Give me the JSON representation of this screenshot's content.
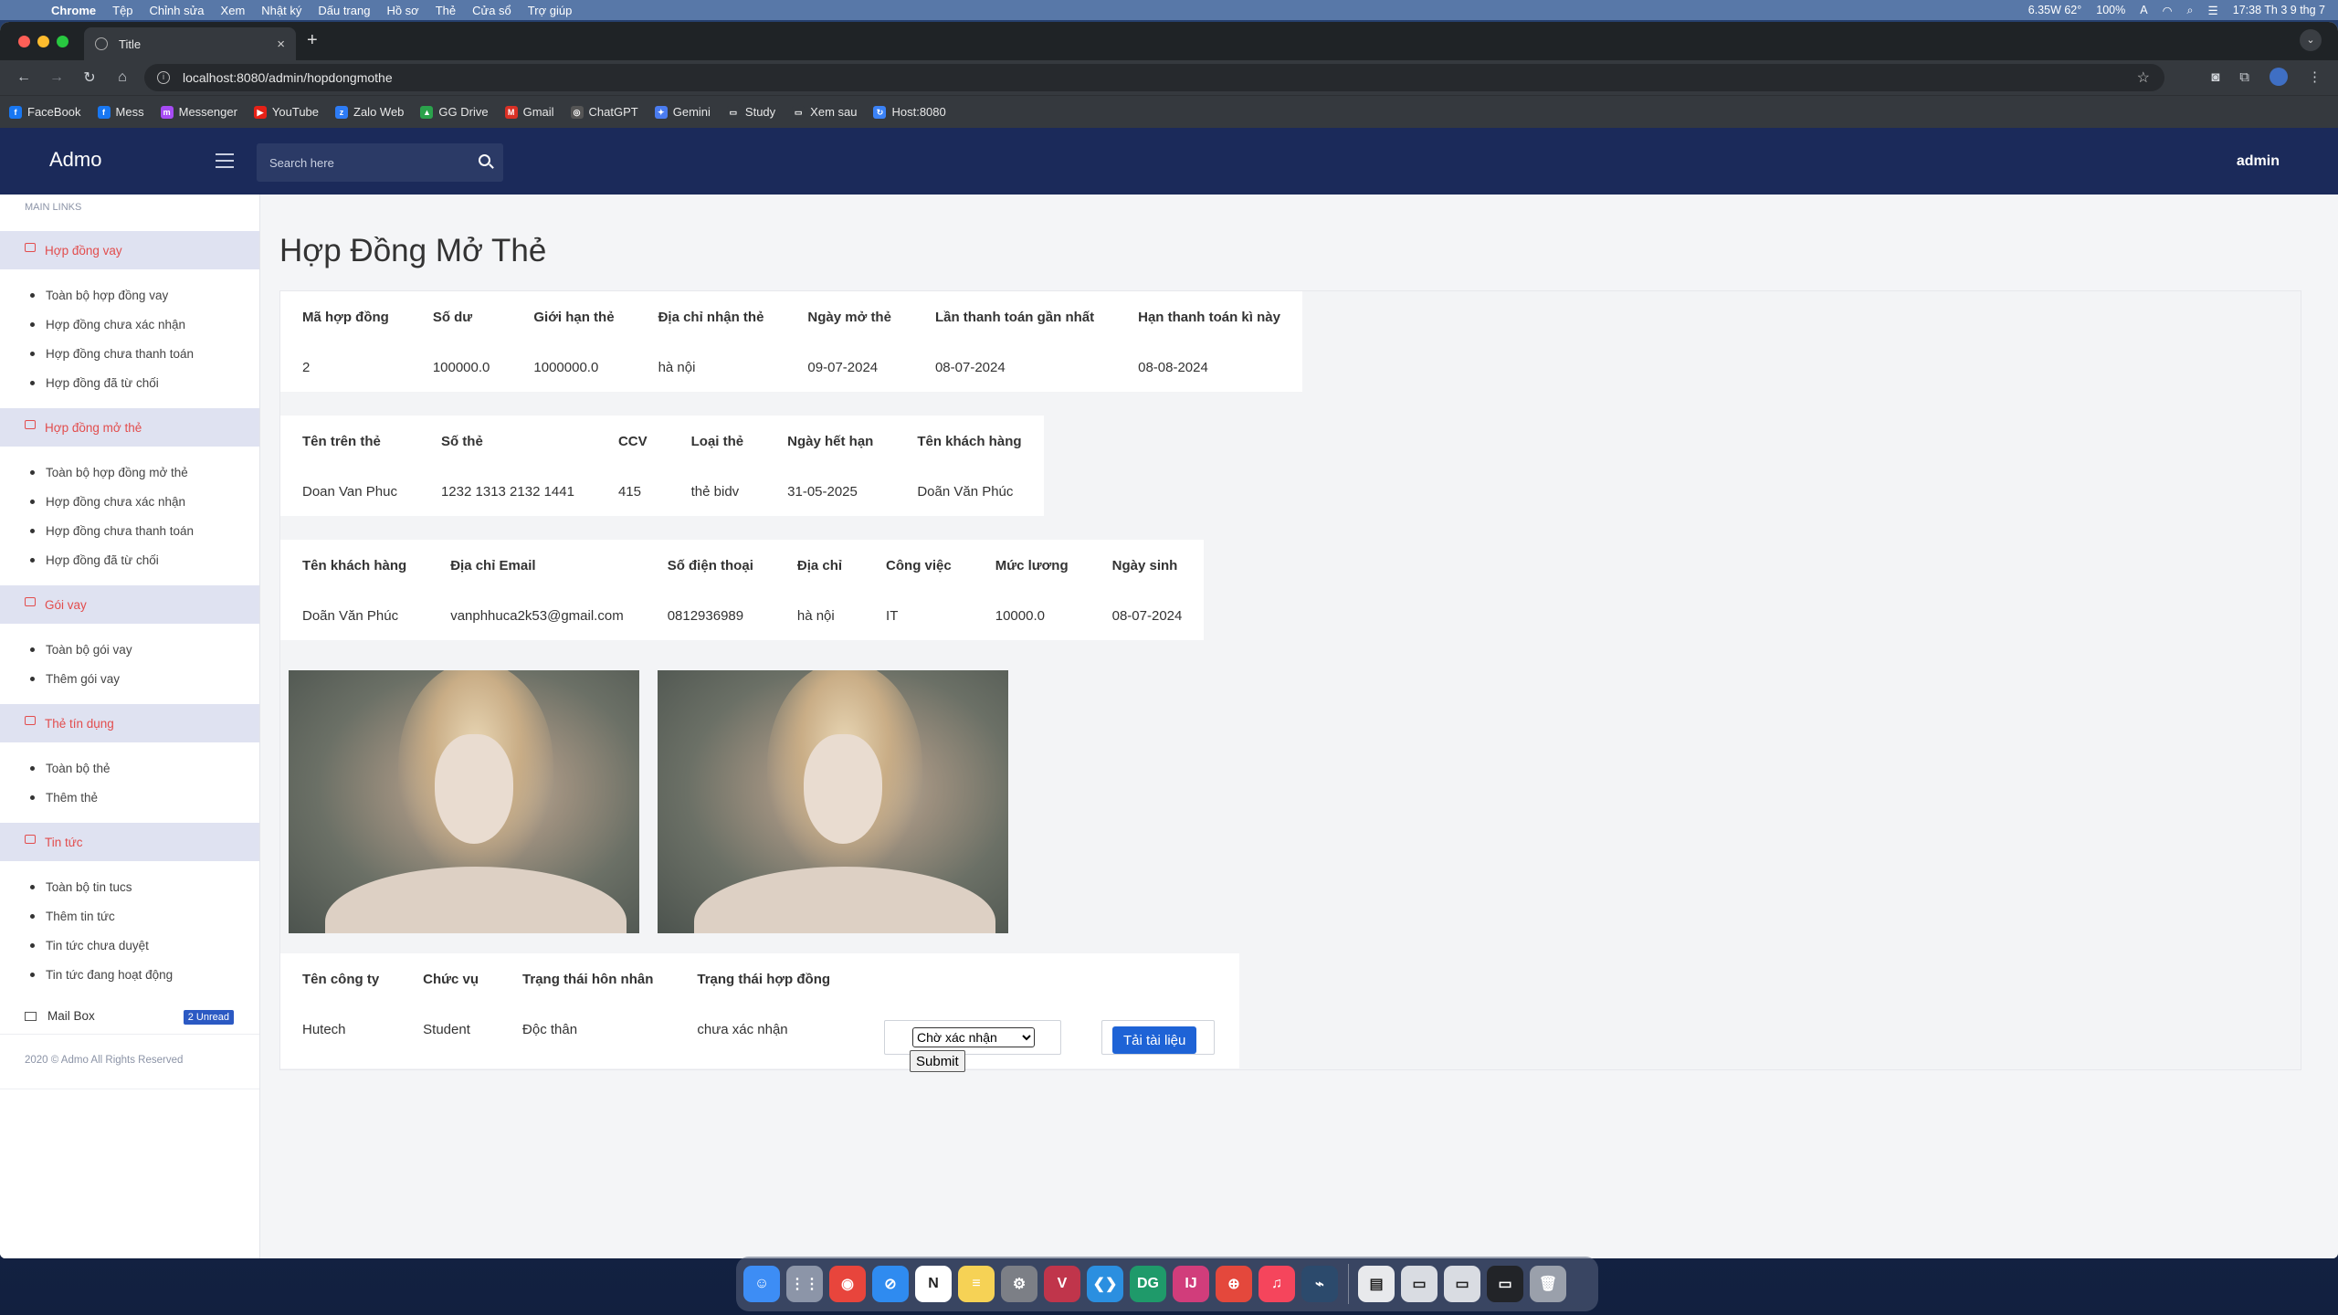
{
  "menubar": {
    "app": "Chrome",
    "items": [
      "Tệp",
      "Chỉnh sửa",
      "Xem",
      "Nhật ký",
      "Dấu trang",
      "Hồ sơ",
      "Thẻ",
      "Cửa sổ",
      "Trợ giúp"
    ],
    "weather": "6.35W 62°",
    "battery": "100%",
    "input_indicator": "A",
    "clock": "17:38 Th 3 9 thg 7"
  },
  "browser": {
    "tab_title": "Title",
    "url": "localhost:8080/admin/hopdongmothe",
    "bookmarks": [
      {
        "label": "FaceBook",
        "color": "#1877f2",
        "glyph": "f"
      },
      {
        "label": "Mess",
        "color": "#1877f2",
        "glyph": "f"
      },
      {
        "label": "Messenger",
        "color": "#a64bf4",
        "glyph": "m"
      },
      {
        "label": "YouTube",
        "color": "#e62117",
        "glyph": "▶"
      },
      {
        "label": "Zalo Web",
        "color": "#2d7cf6",
        "glyph": "z"
      },
      {
        "label": "GG Drive",
        "color": "#2ba24c",
        "glyph": "▲"
      },
      {
        "label": "Gmail",
        "color": "#d93025",
        "glyph": "M"
      },
      {
        "label": "ChatGPT",
        "color": "#555555",
        "glyph": "◎"
      },
      {
        "label": "Gemini",
        "color": "#4a7cf0",
        "glyph": "✦"
      },
      {
        "label": "Study",
        "color": "#35393e",
        "glyph": "▭"
      },
      {
        "label": "Xem sau",
        "color": "#35393e",
        "glyph": "▭"
      },
      {
        "label": "Host:8080",
        "color": "#3b82f6",
        "glyph": "↻"
      }
    ]
  },
  "header": {
    "brand": "Admo",
    "search_placeholder": "Search here",
    "user": "admin"
  },
  "sidebar": {
    "section_label": "MAIN LINKS",
    "groups": [
      {
        "title": "Hợp đồng vay",
        "items": [
          "Toàn bộ hợp đồng vay",
          "Hợp đồng chưa xác nhận",
          "Hợp đồng chưa thanh toán",
          "Hợp đồng đã từ chối"
        ]
      },
      {
        "title": "Hợp đồng mở thẻ",
        "items": [
          "Toàn bộ hợp đồng mở thẻ",
          "Hợp đồng chưa xác nhận",
          "Hợp đồng chưa thanh toán",
          "Hợp đồng đã từ chối"
        ]
      },
      {
        "title": "Gói vay",
        "items": [
          "Toàn bộ gói vay",
          "Thêm gói vay"
        ]
      },
      {
        "title": "Thẻ tín dụng",
        "items": [
          "Toàn bộ thẻ",
          "Thêm thẻ"
        ]
      },
      {
        "title": "Tin tức",
        "items": [
          "Toàn bộ tin tucs",
          "Thêm tin tức",
          "Tin tức chưa duyệt",
          "Tin tức đang hoạt động"
        ]
      }
    ],
    "mailbox_label": "Mail Box",
    "mailbox_badge": "2 Unread",
    "copyright": "2020 © Admo All Rights Reserved"
  },
  "main": {
    "title": "Hợp Đồng Mở Thẻ",
    "contract_table": {
      "headers": [
        "Mã hợp đồng",
        "Số dư",
        "Giới hạn thẻ",
        "Địa chỉ nhận thẻ",
        "Ngày mở thẻ",
        "Lần thanh toán gần nhất",
        "Hạn thanh toán kì này"
      ],
      "row": [
        "2",
        "100000.0",
        "1000000.0",
        "hà nội",
        "09-07-2024",
        "08-07-2024",
        "08-08-2024"
      ]
    },
    "card_table": {
      "headers": [
        "Tên trên thẻ",
        "Số thẻ",
        "CCV",
        "Loại thẻ",
        "Ngày hết hạn",
        "Tên khách hàng"
      ],
      "row": [
        "Doan Van Phuc",
        "1232 1313 2132 1441",
        "415",
        "thẻ bidv",
        "31-05-2025",
        "Doãn Văn Phúc"
      ]
    },
    "customer_table": {
      "headers": [
        "Tên khách hàng",
        "Địa chỉ Email",
        "Số điện thoại",
        "Địa chỉ",
        "Công việc",
        "Mức lương",
        "Ngày sinh"
      ],
      "row": [
        "Doãn Văn Phúc",
        "vanphhuca2k53@gmail.com",
        "0812936989",
        "hà nội",
        "IT",
        "10000.0",
        "08-07-2024"
      ]
    },
    "status_table": {
      "headers": [
        "Tên công ty",
        "Chức vụ",
        "Trạng thái hôn nhân",
        "Trạng thái hợp đồng"
      ],
      "row": [
        "Hutech",
        "Student",
        "Độc thân",
        "chưa xác nhận"
      ]
    },
    "status_select_value": "Chờ xác nhận",
    "submit_label": "Submit",
    "upload_label": "Tải tài liệu"
  },
  "dock": [
    {
      "name": "finder",
      "color": "#3d8df5",
      "glyph": "☺"
    },
    {
      "name": "launchpad",
      "color": "#8c95a8",
      "glyph": "⋮⋮"
    },
    {
      "name": "chrome",
      "color": "#e8453c",
      "glyph": "◉"
    },
    {
      "name": "safari",
      "color": "#2f8bf0",
      "glyph": "⊘"
    },
    {
      "name": "notion",
      "color": "#ffffff",
      "glyph": "N"
    },
    {
      "name": "notes",
      "color": "#f6d255",
      "glyph": "≡"
    },
    {
      "name": "settings",
      "color": "#7c7f86",
      "glyph": "⚙"
    },
    {
      "name": "vivaldi",
      "color": "#c0354b",
      "glyph": "V"
    },
    {
      "name": "vscode",
      "color": "#2b8fe0",
      "glyph": "❮❯"
    },
    {
      "name": "datagrip",
      "color": "#1f9a6a",
      "glyph": "DG"
    },
    {
      "name": "intellij",
      "color": "#d13d7b",
      "glyph": "IJ"
    },
    {
      "name": "thermometer",
      "color": "#e4483c",
      "glyph": "⊕"
    },
    {
      "name": "music",
      "color": "#f5455c",
      "glyph": "♫"
    },
    {
      "name": "mysql-workbench",
      "color": "#2c4a6c",
      "glyph": "⌁"
    },
    {
      "name": "document",
      "color": "#e8e9ec",
      "glyph": "▤"
    },
    {
      "name": "window-1",
      "color": "#d9dce2",
      "glyph": "▭"
    },
    {
      "name": "window-2",
      "color": "#d9dce2",
      "glyph": "▭"
    },
    {
      "name": "window-3",
      "color": "#222428",
      "glyph": "▭"
    },
    {
      "name": "trash",
      "color": "#9aa0ab",
      "glyph": "🗑"
    }
  ]
}
